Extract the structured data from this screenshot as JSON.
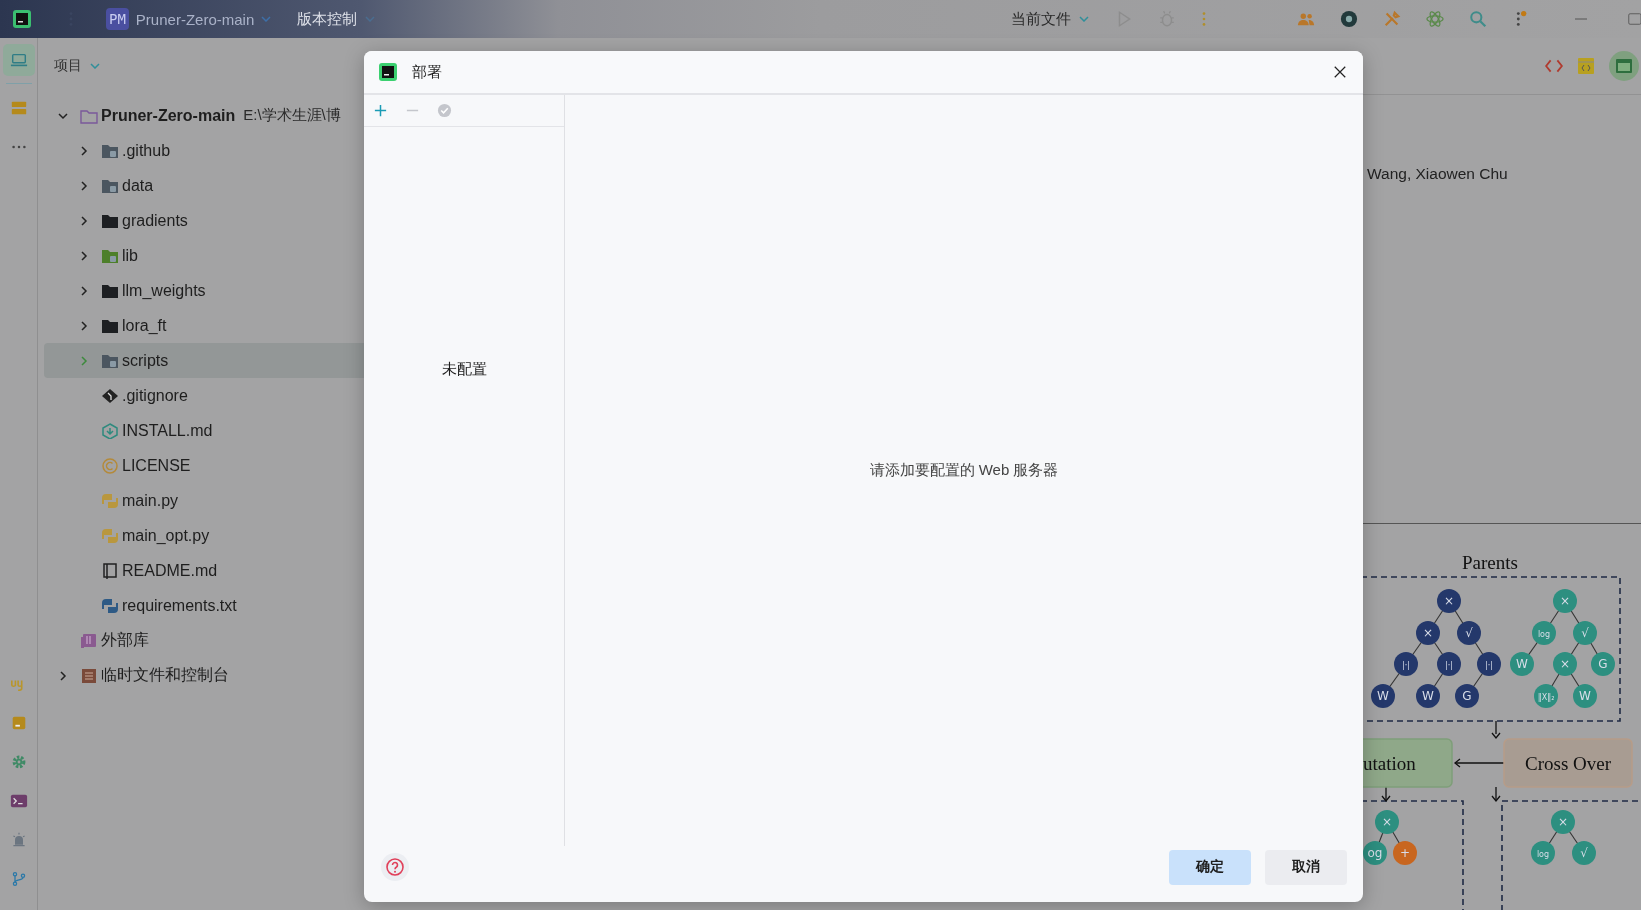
{
  "topbar": {
    "project_badge": "PM",
    "project_name": "Pruner-Zero-main",
    "vcs": "版本控制",
    "run_config": "当前文件"
  },
  "tool_strip": {
    "top": [
      {
        "kind": "laptop",
        "selected": true
      },
      {
        "kind": "storage",
        "selected": false
      },
      {
        "kind": "more",
        "selected": false
      }
    ],
    "bottom": [
      {
        "kind": "python",
        "selected": false
      },
      {
        "kind": "bookmark",
        "selected": false
      },
      {
        "kind": "gear",
        "selected": false
      },
      {
        "kind": "terminal",
        "selected": false
      },
      {
        "kind": "alert",
        "selected": false
      },
      {
        "kind": "git",
        "selected": false
      }
    ]
  },
  "project_panel": {
    "title": "项目",
    "tree": [
      {
        "name": "Pruner-Zero-main",
        "path": "E:\\学术生涯\\博",
        "kind": "module",
        "expanded": true,
        "selected": false,
        "children": [
          {
            "name": ".github",
            "kind": "folder-github",
            "expanded": false,
            "selected": false
          },
          {
            "name": "data",
            "kind": "folder-data",
            "expanded": false,
            "selected": false
          },
          {
            "name": "gradients",
            "kind": "folder",
            "expanded": false,
            "selected": false
          },
          {
            "name": "lib",
            "kind": "folder-lib",
            "expanded": false,
            "selected": false
          },
          {
            "name": "llm_weights",
            "kind": "folder",
            "expanded": false,
            "selected": false
          },
          {
            "name": "lora_ft",
            "kind": "folder",
            "expanded": false,
            "selected": false
          },
          {
            "name": "scripts",
            "kind": "folder-scripts",
            "expanded": false,
            "selected": true
          },
          {
            "name": ".gitignore",
            "kind": "git",
            "selected": false
          },
          {
            "name": "INSTALL.md",
            "kind": "install",
            "selected": false
          },
          {
            "name": "LICENSE",
            "kind": "license",
            "selected": false
          },
          {
            "name": "main.py",
            "kind": "python",
            "selected": false
          },
          {
            "name": "main_opt.py",
            "kind": "python",
            "selected": false
          },
          {
            "name": "README.md",
            "kind": "readme",
            "selected": false
          },
          {
            "name": "requirements.txt",
            "kind": "requirements",
            "selected": false
          }
        ]
      },
      {
        "name": "外部库",
        "kind": "library",
        "selected": false
      },
      {
        "name": "临时文件和控制台",
        "kind": "scratch",
        "expanded": false,
        "selected": false
      }
    ]
  },
  "preview": {
    "authors": "Wang, Xiaowen Chu",
    "figure": {
      "title": "Parents",
      "trees": [
        {
          "nodes": [
            {
              "label": "×",
              "color": "#24386b"
            },
            {
              "label": "×",
              "color": "#24386b"
            },
            {
              "label": "√",
              "color": "#24386b"
            },
            {
              "label": "|·|",
              "color": "#24386b"
            },
            {
              "label": "|·|",
              "color": "#24386b"
            },
            {
              "label": "|·|",
              "color": "#24386b"
            },
            {
              "label": "W",
              "color": "#24386b"
            },
            {
              "label": "W",
              "color": "#24386b"
            },
            {
              "label": "G",
              "color": "#24386b"
            }
          ]
        },
        {
          "nodes": [
            {
              "label": "×",
              "color": "#2d8f80"
            },
            {
              "label": "log",
              "color": "#2d8f80"
            },
            {
              "label": "√",
              "color": "#2d8f80"
            },
            {
              "label": "W",
              "color": "#2d8f80"
            },
            {
              "label": "×",
              "color": "#2d8f80"
            },
            {
              "label": "G",
              "color": "#2d8f80"
            },
            {
              "label": "‖X‖₂",
              "color": "#2d8f80"
            },
            {
              "label": "W",
              "color": "#2d8f80"
            }
          ]
        },
        {
          "nodes": [
            {
              "label": "×",
              "color": "#2d8f80"
            },
            {
              "label": "og",
              "color": "#2d8f80"
            },
            {
              "label": "+",
              "color": "#c8661f"
            }
          ]
        },
        {
          "nodes": [
            {
              "label": "×",
              "color": "#2d8f80"
            },
            {
              "label": "log",
              "color": "#2d8f80"
            },
            {
              "label": "√",
              "color": "#2d8f80"
            }
          ]
        }
      ],
      "mutation": "utation",
      "crossover": "Cross Over"
    }
  },
  "dialog": {
    "title": "部署",
    "toolbar": [
      {
        "kind": "add",
        "disabled": false
      },
      {
        "kind": "remove",
        "disabled": true
      },
      {
        "kind": "check",
        "disabled": true
      }
    ],
    "empty_list": "未配置",
    "empty_hint": "请添加要配置的 Web 服务器",
    "buttons": [
      {
        "label": "确定",
        "default": true
      },
      {
        "label": "取消",
        "default": false
      }
    ]
  }
}
